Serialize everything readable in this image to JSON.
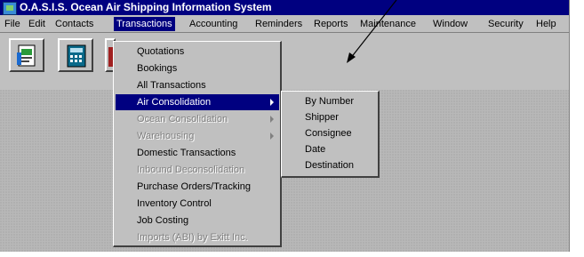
{
  "window": {
    "title": "O.A.S.I.S.   Ocean Air Shipping Information System"
  },
  "menubar": {
    "items": [
      {
        "label": "File"
      },
      {
        "label": "Edit"
      },
      {
        "label": "Contacts"
      },
      {
        "label": "Transactions"
      },
      {
        "label": "Accounting"
      },
      {
        "label": "Reminders"
      },
      {
        "label": "Reports"
      },
      {
        "label": "Maintenance"
      },
      {
        "label": "Window"
      },
      {
        "label": "Security"
      },
      {
        "label": "Help"
      }
    ],
    "active": "Transactions"
  },
  "toolbar": {
    "buttons": [
      {
        "icon": "document-icon"
      },
      {
        "icon": "calculator-icon"
      },
      {
        "icon": "address-book-icon"
      }
    ]
  },
  "transactions_menu": {
    "items": [
      {
        "label": "Quotations",
        "enabled": true
      },
      {
        "label": "Bookings",
        "enabled": true
      },
      {
        "label": "All Transactions",
        "enabled": true
      },
      {
        "label": "Air Consolidation",
        "enabled": true,
        "submenu": true,
        "highlighted": true
      },
      {
        "label": "Ocean Consolidation",
        "enabled": false,
        "submenu": true
      },
      {
        "label": "Warehousing",
        "enabled": false,
        "submenu": true
      },
      {
        "label": "Domestic Transactions",
        "enabled": true
      },
      {
        "label": "Inbound Deconsolidation",
        "enabled": false
      },
      {
        "label": "Purchase Orders/Tracking",
        "enabled": true
      },
      {
        "label": "Inventory Control",
        "enabled": true
      },
      {
        "label": "Job Costing",
        "enabled": true
      },
      {
        "label": "Imports (ABI) by Exitt Inc.",
        "enabled": false
      }
    ]
  },
  "air_consolidation_submenu": {
    "items": [
      {
        "label": "By Number"
      },
      {
        "label": "Shipper"
      },
      {
        "label": "Consignee"
      },
      {
        "label": "Date"
      },
      {
        "label": "Destination"
      }
    ]
  },
  "colors": {
    "titlebar": "#000080",
    "highlight": "#000080",
    "face": "#c0c0c0"
  }
}
